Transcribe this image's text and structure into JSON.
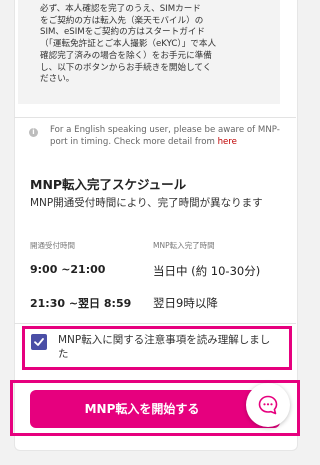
{
  "notice": {
    "text": "必ず、本人確認を完了のうえ、SIMカード\nをご契約の方は転入先（楽天モバイル）の\nSIM、eSIMをご契約の方はスタートガイド\n（「運転免許証とご本人撮影（eKYC）」で本人\n確認完了済みの場合を除く）をお手元に準備\nし、以下のボタンからお手続きを開始してく\nださい。"
  },
  "info": {
    "icon": "info-icon",
    "text": "For a English speaking user, please be aware of MNP-port in timing.  Check more detail from ",
    "link": "here"
  },
  "schedule": {
    "title": "MNP転入完了スケジュール",
    "description": "MNP開通受付時間により、完了時間が異なります",
    "col_time": "開通受付時間",
    "col_result": "MNP転入完了時間",
    "rows": [
      {
        "time": "9:00 ~21:00",
        "result": "当日中 (約 10-30分)"
      },
      {
        "time": "21:30 ~翌日 8:59",
        "result": "翌日9時以降"
      }
    ]
  },
  "agreement": {
    "checked": true,
    "label": "MNP転入に関する注意事項を読み理解しました"
  },
  "start_button": {
    "label": "MNP転入を開始する"
  },
  "chat": {
    "icon": "chat-bubble-icon"
  },
  "colors": {
    "accent": "#e6007e",
    "link": "#bf0000",
    "checkbox": "#4a4ea6"
  }
}
